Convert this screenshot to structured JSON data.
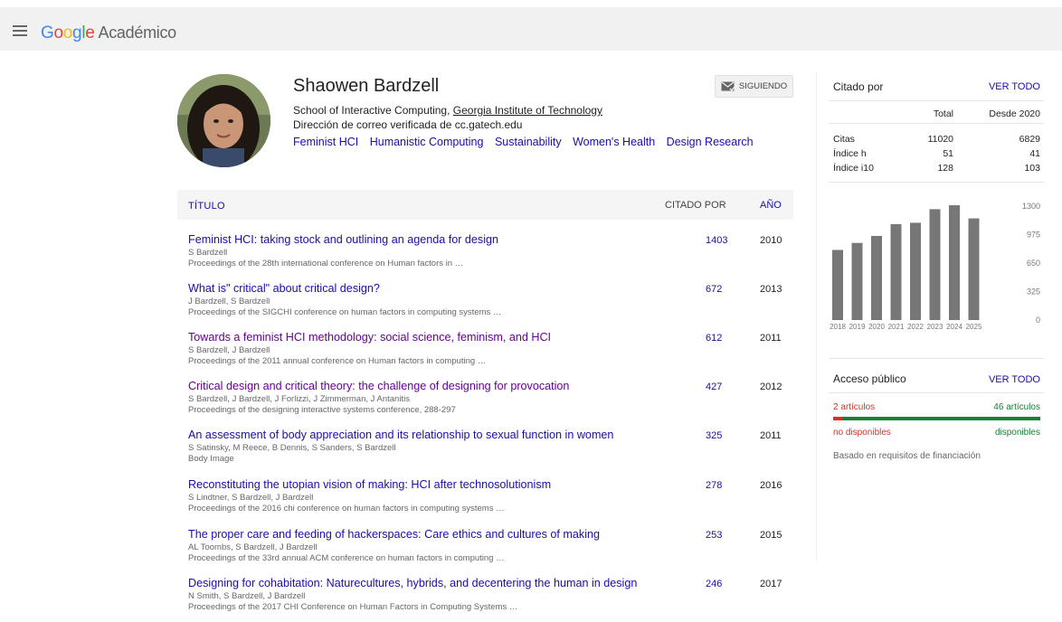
{
  "header": {
    "logo_text": "Google",
    "product": "Académico"
  },
  "profile": {
    "name": "Shaowen Bardzell",
    "affiliation_prefix": "School of Interactive Computing, ",
    "affiliation_link": "Georgia Institute of Technology",
    "email": "Dirección de correo verificada de cc.gatech.edu",
    "interests": [
      "Feminist HCI",
      "Humanistic Computing",
      "Sustainability",
      "Women's Health",
      "Design Research"
    ],
    "follow_label": "SIGUIENDO"
  },
  "table": {
    "col_title": "TÍTULO",
    "col_cited": "CITADO POR",
    "col_year": "AÑO",
    "rows": [
      {
        "title": "Feminist HCI: taking stock and outlining an agenda for design",
        "authors": "S Bardzell",
        "venue": "Proceedings of the 28th international conference on Human factors in …",
        "cited": "1403",
        "year": "2010"
      },
      {
        "title": "What is\" critical\" about critical design?",
        "authors": "J Bardzell, S Bardzell",
        "venue": "Proceedings of the SIGCHI conference on human factors in computing systems …",
        "cited": "672",
        "year": "2013"
      },
      {
        "title": "Towards a feminist HCI methodology: social science, feminism, and HCI",
        "authors": "S Bardzell, J Bardzell",
        "venue": "Proceedings of the 2011 annual conference on Human factors in computing …",
        "cited": "612",
        "year": "2011"
      },
      {
        "title": "Critical design and critical theory: the challenge of designing for provocation",
        "authors": "S Bardzell, J Bardzell, J Forlizzi, J Zimmerman, J Antanitis",
        "venue": "Proceedings of the designing interactive systems conference, 288-297",
        "cited": "427",
        "year": "2012"
      },
      {
        "title": "An assessment of body appreciation and its relationship to sexual function in women",
        "authors": "S Satinsky, M Reece, B Dennis, S Sanders, S Bardzell",
        "venue": "Body Image",
        "cited": "325",
        "year": "2011"
      },
      {
        "title": "Reconstituting the utopian vision of making: HCI after technosolutionism",
        "authors": "S Lindtner, S Bardzell, J Bardzell",
        "venue": "Proceedings of the 2016 chi conference on human factors in computing systems …",
        "cited": "278",
        "year": "2016"
      },
      {
        "title": "The proper care and feeding of hackerspaces: Care ethics and cultures of making",
        "authors": "AL Toombs, S Bardzell, J Bardzell",
        "venue": "Proceedings of the 33rd annual ACM conference on human factors in computing …",
        "cited": "253",
        "year": "2015"
      },
      {
        "title": "Designing for cohabitation: Naturecultures, hybrids, and decentering the human in design",
        "authors": "N Smith, S Bardzell, J Bardzell",
        "venue": "Proceedings of the 2017 CHI Conference on Human Factors in Computing Systems …",
        "cited": "246",
        "year": "2017"
      }
    ]
  },
  "cited_by": {
    "title": "Citado por",
    "view_all": "VER TODO",
    "col_total": "Total",
    "col_since": "Desde 2020",
    "rows": [
      {
        "label": "Citas",
        "total": "11020",
        "since": "6829"
      },
      {
        "label": "Índice h",
        "total": "51",
        "since": "41"
      },
      {
        "label": "Índice i10",
        "total": "128",
        "since": "103"
      }
    ]
  },
  "chart_data": {
    "type": "bar",
    "categories": [
      "2018",
      "2019",
      "2020",
      "2021",
      "2022",
      "2023",
      "2024",
      "2025"
    ],
    "values": [
      800,
      880,
      960,
      1095,
      1110,
      1265,
      1310,
      1160
    ],
    "ylim": [
      0,
      1300
    ],
    "yticks": [
      "1300",
      "975",
      "650",
      "325",
      "0"
    ],
    "bar_color": "#777777"
  },
  "public_access": {
    "title": "Acceso público",
    "view_all": "VER TODO",
    "not_available_count": "2 artículos",
    "available_count": "46 artículos",
    "not_available_label": "no disponibles",
    "available_label": "disponibles",
    "not_available_fraction": 0.042,
    "note": "Basado en requisitos de financiación"
  },
  "colors": {
    "link": "#1a0dab",
    "visited": "#660099",
    "red": "#d93025",
    "green": "#188038"
  }
}
